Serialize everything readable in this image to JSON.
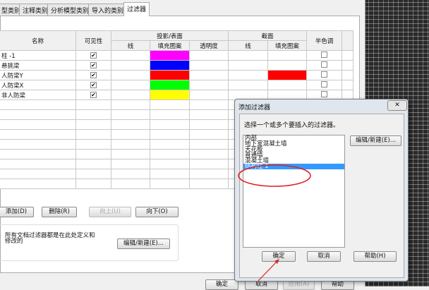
{
  "tabs": [
    "型类别",
    "注释类别",
    "分析模型类别",
    "导入的类别",
    "过滤器"
  ],
  "table": {
    "headers": {
      "name": "名称",
      "visibility": "可见性",
      "projection": "投影/表面",
      "line": "线",
      "fill": "填充图案",
      "transparency": "透明度",
      "cut": "截面",
      "cut_line": "线",
      "cut_fill": "填充图案",
      "halftone": "半色调"
    },
    "rows": [
      {
        "name": "柱  -1",
        "visible": true,
        "fill": "#ff00ff",
        "cut_fill": "",
        "halftone": false
      },
      {
        "name": "悬挑梁",
        "visible": true,
        "fill": "#0000ff",
        "cut_fill": "",
        "halftone": false
      },
      {
        "name": "人防梁Y",
        "visible": true,
        "fill": "#ff0000",
        "cut_fill": "#ff0000",
        "halftone": false
      },
      {
        "name": "人防梁X",
        "visible": true,
        "fill": "#00ff00",
        "cut_fill": "",
        "halftone": false
      },
      {
        "name": "非人防梁",
        "visible": true,
        "fill": "#ffff00",
        "cut_fill": "",
        "halftone": false
      }
    ]
  },
  "buttons": {
    "add": "添加(D)",
    "delete": "删除(R)",
    "up": "向上(U)",
    "down": "向下(O)",
    "edit_new": "编辑/新建(E)...",
    "ok": "确定",
    "cancel": "取消",
    "apply": "应用(A)",
    "help": "帮助"
  },
  "group_text": "所有文档过滤器都是在此处定义和修改的",
  "dialog": {
    "title": "添加过滤器",
    "close": "✕",
    "prompt": "选择一个或多个要插入的过滤器。",
    "items": [
      "内部",
      "地下室混凝土墙",
      "天花板",
      "普通墙",
      "混凝土墙",
      "结构柱 1"
    ],
    "selected_index": 5,
    "edit_new": "编辑/新建(E)...",
    "ok": "确定",
    "cancel": "取消",
    "help": "帮助(H)"
  }
}
